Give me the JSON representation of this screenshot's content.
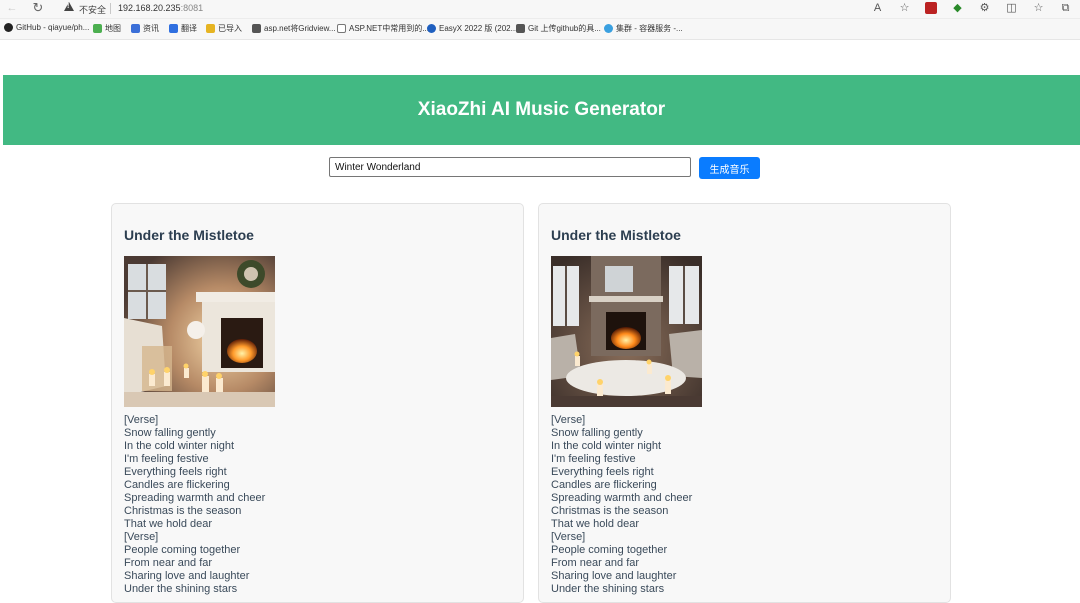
{
  "browser": {
    "insecure_label": "不安全",
    "url_host": "192.168.20.235",
    "url_port": ":8081",
    "bookmarks": [
      {
        "label": "GitHub - qiayue/ph...",
        "icon_color": "#222222"
      },
      {
        "label": "地图",
        "icon_color": "#4caf50"
      },
      {
        "label": "资讯",
        "icon_color": "#3b6fd8"
      },
      {
        "label": "翻译",
        "icon_color": "#2f6fe0"
      },
      {
        "label": "已导入",
        "icon_color": "#e6b422"
      },
      {
        "label": "asp.net将Gridview...",
        "icon_color": "#555555"
      },
      {
        "label": "ASP.NET中常用到的...",
        "icon_color": "#777777"
      },
      {
        "label": "EasyX 2022 版 (202...",
        "icon_color": "#1f5fbf"
      },
      {
        "label": "Git 上传github的具...",
        "icon_color": "#555555"
      },
      {
        "label": "集群 - 容器服务 -...",
        "icon_color": "#3aa0e0"
      }
    ]
  },
  "app": {
    "title": "XiaoZhi AI Music Generator",
    "search_value": "Winter Wonderland",
    "generate_label": "生成音乐",
    "accent": "#42b983",
    "button_color": "#0a7cff"
  },
  "cards": [
    {
      "title": "Under the Mistletoe",
      "cover_icon": "cozy-fireplace-candles-image",
      "lyrics": [
        "[Verse]",
        "Snow falling gently",
        "In the cold winter night",
        "I'm feeling festive",
        "Everything feels right",
        "Candles are flickering",
        "Spreading warmth and cheer",
        "Christmas is the season",
        "That we hold dear",
        "[Verse]",
        "People coming together",
        "From near and far",
        "Sharing love and laughter",
        "Under the shining stars"
      ]
    },
    {
      "title": "Under the Mistletoe",
      "cover_icon": "stone-fireplace-living-room-image",
      "lyrics": [
        "[Verse]",
        "Snow falling gently",
        "In the cold winter night",
        "I'm feeling festive",
        "Everything feels right",
        "Candles are flickering",
        "Spreading warmth and cheer",
        "Christmas is the season",
        "That we hold dear",
        "[Verse]",
        "People coming together",
        "From near and far",
        "Sharing love and laughter",
        "Under the shining stars"
      ]
    }
  ]
}
